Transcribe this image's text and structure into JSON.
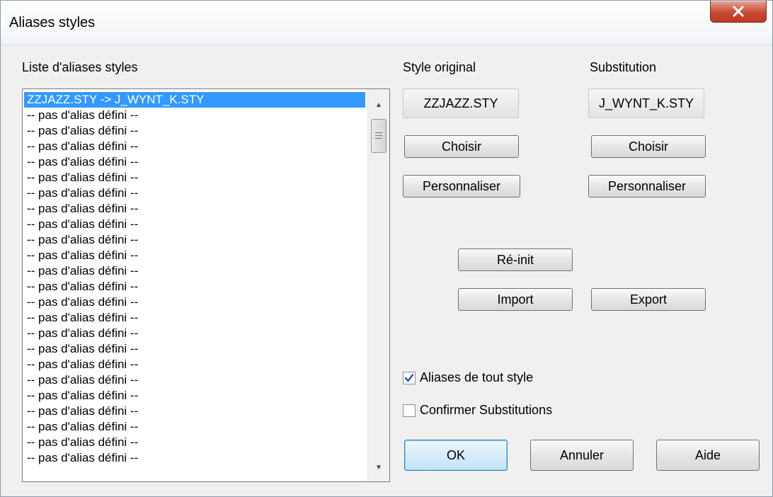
{
  "window": {
    "title": "Aliases styles",
    "close_icon": "close-x-icon"
  },
  "list": {
    "label": "Liste d'aliases styles",
    "items": [
      "ZZJAZZ.STY -> J_WYNT_K.STY",
      "-- pas d'alias défini --",
      "-- pas d'alias défini --",
      "-- pas d'alias défini --",
      "-- pas d'alias défini --",
      "-- pas d'alias défini --",
      "-- pas d'alias défini --",
      "-- pas d'alias défini --",
      "-- pas d'alias défini --",
      "-- pas d'alias défini --",
      "-- pas d'alias défini --",
      "-- pas d'alias défini --",
      "-- pas d'alias défini --",
      "-- pas d'alias défini --",
      "-- pas d'alias défini --",
      "-- pas d'alias défini --",
      "-- pas d'alias défini --",
      "-- pas d'alias défini --",
      "-- pas d'alias défini --",
      "-- pas d'alias défini --",
      "-- pas d'alias défini --",
      "-- pas d'alias défini --",
      "-- pas d'alias défini --",
      "-- pas d'alias défini --"
    ],
    "selected_index": 0
  },
  "original": {
    "label": "Style original",
    "value": "ZZJAZZ.STY",
    "choose_label": "Choisir",
    "customize_label": "Personnaliser"
  },
  "substitution": {
    "label": "Substitution",
    "value": "J_WYNT_K.STY",
    "choose_label": "Choisir",
    "customize_label": "Personnaliser"
  },
  "actions": {
    "reset_label": "Ré-init",
    "import_label": "Import",
    "export_label": "Export"
  },
  "options": {
    "alias_all_label": "Aliases de tout style",
    "alias_all_checked": true,
    "confirm_label": "Confirmer Substitutions",
    "confirm_checked": false
  },
  "footer": {
    "ok_label": "OK",
    "cancel_label": "Annuler",
    "help_label": "Aide"
  }
}
